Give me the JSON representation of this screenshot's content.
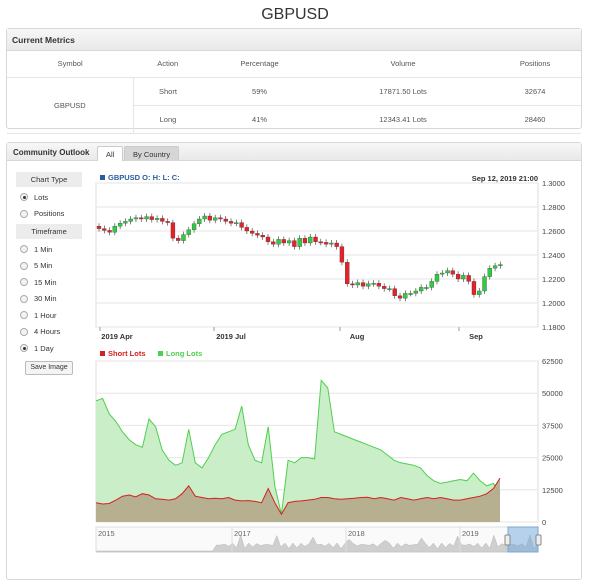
{
  "page_title": "GBPUSD",
  "metrics": {
    "header": "Current Metrics",
    "columns": [
      "Symbol",
      "Action",
      "Percentage",
      "Volume",
      "Positions"
    ],
    "symbol": "GBPUSD",
    "rows": [
      {
        "action": "Short",
        "percentage": "59%",
        "volume": "17871.50 Lots",
        "positions": "32674"
      },
      {
        "action": "Long",
        "percentage": "41%",
        "volume": "12343.41 Lots",
        "positions": "28460"
      }
    ]
  },
  "outlook": {
    "title": "Community Outlook",
    "tabs": [
      {
        "label": "All",
        "active": true
      },
      {
        "label": "By Country",
        "active": false
      }
    ]
  },
  "sidebar": {
    "chart_type_header": "Chart Type",
    "chart_types": [
      {
        "label": "Lots",
        "checked": true
      },
      {
        "label": "Positions",
        "checked": false
      }
    ],
    "timeframe_header": "Timeframe",
    "timeframes": [
      {
        "label": "1 Min",
        "checked": false
      },
      {
        "label": "5 Min",
        "checked": false
      },
      {
        "label": "15 Min",
        "checked": false
      },
      {
        "label": "30 Min",
        "checked": false
      },
      {
        "label": "1 Hour",
        "checked": false
      },
      {
        "label": "4 Hours",
        "checked": false
      },
      {
        "label": "1 Day",
        "checked": true
      }
    ],
    "save_label": "Save Image"
  },
  "colors": {
    "up": "#2ecc40",
    "down": "#e8202a",
    "long_fill": "#c9eec8",
    "long_line": "#4fcf4f",
    "short_fill": "#b5a98a",
    "short_line": "#d42020",
    "legend_square": "#2a5d9f"
  },
  "chart_data": [
    {
      "type": "candlestick",
      "legend": "GBPUSD O: H: L: C:",
      "timestamp": "Sep 12, 2019 21:00",
      "x_tick_labels": [
        "2019 Apr",
        "2019 Jul",
        "Aug",
        "Sep"
      ],
      "y_tick_labels": [
        "1.3000",
        "1.2800",
        "1.2600",
        "1.2400",
        "1.2200",
        "1.2000",
        "1.1800"
      ],
      "ylim": [
        1.18,
        1.3
      ],
      "closes": [
        1.262,
        1.2605,
        1.259,
        1.264,
        1.2665,
        1.268,
        1.27,
        1.271,
        1.27,
        1.272,
        1.2695,
        1.2705,
        1.268,
        1.267,
        1.254,
        1.252,
        1.257,
        1.261,
        1.266,
        1.27,
        1.2725,
        1.269,
        1.271,
        1.27,
        1.268,
        1.2665,
        1.267,
        1.263,
        1.26,
        1.258,
        1.2565,
        1.255,
        1.251,
        1.249,
        1.253,
        1.25,
        1.252,
        1.247,
        1.254,
        1.25,
        1.255,
        1.251,
        1.2505,
        1.249,
        1.25,
        1.247,
        1.234,
        1.216,
        1.215,
        1.217,
        1.214,
        1.216,
        1.2165,
        1.214,
        1.212,
        1.212,
        1.206,
        1.204,
        1.208,
        1.208,
        1.21,
        1.213,
        1.213,
        1.218,
        1.224,
        1.225,
        1.227,
        1.224,
        1.22,
        1.223,
        1.218,
        1.207,
        1.21,
        1.222,
        1.229,
        1.231,
        1.232
      ]
    },
    {
      "type": "area",
      "series": [
        {
          "name": "Short Lots",
          "values": [
            7500,
            7000,
            7200,
            8500,
            10000,
            10500,
            9800,
            11000,
            10500,
            9000,
            8800,
            8500,
            9000,
            11000,
            14000,
            10000,
            9500,
            9000,
            9200,
            9000,
            9500,
            8500,
            8200,
            8300,
            8000,
            7500,
            13000,
            7500,
            3000,
            7500,
            8000,
            8200,
            8500,
            8800,
            9500,
            9500,
            9000,
            8800,
            9000,
            9200,
            9500,
            9600,
            9000,
            9500,
            9000,
            8500,
            9500,
            9000,
            8500,
            9000,
            9500,
            9000,
            9500,
            9000,
            8500,
            8500,
            9000,
            9500,
            10000,
            11000,
            13000,
            17000
          ]
        },
        {
          "name": "Long Lots",
          "values": [
            47000,
            48000,
            42000,
            39000,
            35000,
            32000,
            30000,
            29000,
            40000,
            37000,
            28000,
            24000,
            22000,
            23000,
            36000,
            23000,
            21000,
            25000,
            30000,
            34000,
            35000,
            36000,
            45000,
            30000,
            24000,
            23000,
            37000,
            14000,
            3000,
            24000,
            23000,
            25000,
            25000,
            24500,
            55000,
            52000,
            35000,
            34000,
            33000,
            32000,
            31000,
            30000,
            29000,
            28000,
            26000,
            24000,
            23000,
            22500,
            22000,
            21000,
            18000,
            16000,
            15000,
            15500,
            16000,
            16500,
            16000,
            19000,
            16000,
            14000,
            15000,
            11000
          ]
        }
      ],
      "y_tick_labels": [
        "62500",
        "50000",
        "37500",
        "25000",
        "12500",
        "0"
      ],
      "ylim": [
        0,
        62500
      ]
    }
  ],
  "navigator": {
    "labels": [
      "2015",
      "2017",
      "2018",
      "2019"
    ]
  }
}
